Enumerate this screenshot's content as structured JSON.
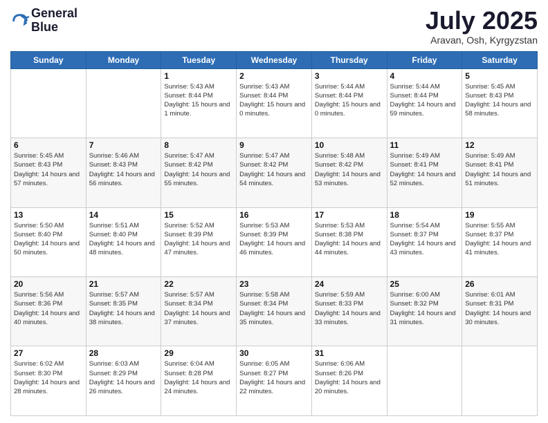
{
  "logo": {
    "line1": "General",
    "line2": "Blue"
  },
  "header": {
    "month": "July 2025",
    "location": "Aravan, Osh, Kyrgyzstan"
  },
  "weekdays": [
    "Sunday",
    "Monday",
    "Tuesday",
    "Wednesday",
    "Thursday",
    "Friday",
    "Saturday"
  ],
  "weeks": [
    [
      {
        "day": "",
        "sunrise": "",
        "sunset": "",
        "daylight": ""
      },
      {
        "day": "",
        "sunrise": "",
        "sunset": "",
        "daylight": ""
      },
      {
        "day": "1",
        "sunrise": "Sunrise: 5:43 AM",
        "sunset": "Sunset: 8:44 PM",
        "daylight": "Daylight: 15 hours and 1 minute."
      },
      {
        "day": "2",
        "sunrise": "Sunrise: 5:43 AM",
        "sunset": "Sunset: 8:44 PM",
        "daylight": "Daylight: 15 hours and 0 minutes."
      },
      {
        "day": "3",
        "sunrise": "Sunrise: 5:44 AM",
        "sunset": "Sunset: 8:44 PM",
        "daylight": "Daylight: 15 hours and 0 minutes."
      },
      {
        "day": "4",
        "sunrise": "Sunrise: 5:44 AM",
        "sunset": "Sunset: 8:44 PM",
        "daylight": "Daylight: 14 hours and 59 minutes."
      },
      {
        "day": "5",
        "sunrise": "Sunrise: 5:45 AM",
        "sunset": "Sunset: 8:43 PM",
        "daylight": "Daylight: 14 hours and 58 minutes."
      }
    ],
    [
      {
        "day": "6",
        "sunrise": "Sunrise: 5:45 AM",
        "sunset": "Sunset: 8:43 PM",
        "daylight": "Daylight: 14 hours and 57 minutes."
      },
      {
        "day": "7",
        "sunrise": "Sunrise: 5:46 AM",
        "sunset": "Sunset: 8:43 PM",
        "daylight": "Daylight: 14 hours and 56 minutes."
      },
      {
        "day": "8",
        "sunrise": "Sunrise: 5:47 AM",
        "sunset": "Sunset: 8:42 PM",
        "daylight": "Daylight: 14 hours and 55 minutes."
      },
      {
        "day": "9",
        "sunrise": "Sunrise: 5:47 AM",
        "sunset": "Sunset: 8:42 PM",
        "daylight": "Daylight: 14 hours and 54 minutes."
      },
      {
        "day": "10",
        "sunrise": "Sunrise: 5:48 AM",
        "sunset": "Sunset: 8:42 PM",
        "daylight": "Daylight: 14 hours and 53 minutes."
      },
      {
        "day": "11",
        "sunrise": "Sunrise: 5:49 AM",
        "sunset": "Sunset: 8:41 PM",
        "daylight": "Daylight: 14 hours and 52 minutes."
      },
      {
        "day": "12",
        "sunrise": "Sunrise: 5:49 AM",
        "sunset": "Sunset: 8:41 PM",
        "daylight": "Daylight: 14 hours and 51 minutes."
      }
    ],
    [
      {
        "day": "13",
        "sunrise": "Sunrise: 5:50 AM",
        "sunset": "Sunset: 8:40 PM",
        "daylight": "Daylight: 14 hours and 50 minutes."
      },
      {
        "day": "14",
        "sunrise": "Sunrise: 5:51 AM",
        "sunset": "Sunset: 8:40 PM",
        "daylight": "Daylight: 14 hours and 48 minutes."
      },
      {
        "day": "15",
        "sunrise": "Sunrise: 5:52 AM",
        "sunset": "Sunset: 8:39 PM",
        "daylight": "Daylight: 14 hours and 47 minutes."
      },
      {
        "day": "16",
        "sunrise": "Sunrise: 5:53 AM",
        "sunset": "Sunset: 8:39 PM",
        "daylight": "Daylight: 14 hours and 46 minutes."
      },
      {
        "day": "17",
        "sunrise": "Sunrise: 5:53 AM",
        "sunset": "Sunset: 8:38 PM",
        "daylight": "Daylight: 14 hours and 44 minutes."
      },
      {
        "day": "18",
        "sunrise": "Sunrise: 5:54 AM",
        "sunset": "Sunset: 8:37 PM",
        "daylight": "Daylight: 14 hours and 43 minutes."
      },
      {
        "day": "19",
        "sunrise": "Sunrise: 5:55 AM",
        "sunset": "Sunset: 8:37 PM",
        "daylight": "Daylight: 14 hours and 41 minutes."
      }
    ],
    [
      {
        "day": "20",
        "sunrise": "Sunrise: 5:56 AM",
        "sunset": "Sunset: 8:36 PM",
        "daylight": "Daylight: 14 hours and 40 minutes."
      },
      {
        "day": "21",
        "sunrise": "Sunrise: 5:57 AM",
        "sunset": "Sunset: 8:35 PM",
        "daylight": "Daylight: 14 hours and 38 minutes."
      },
      {
        "day": "22",
        "sunrise": "Sunrise: 5:57 AM",
        "sunset": "Sunset: 8:34 PM",
        "daylight": "Daylight: 14 hours and 37 minutes."
      },
      {
        "day": "23",
        "sunrise": "Sunrise: 5:58 AM",
        "sunset": "Sunset: 8:34 PM",
        "daylight": "Daylight: 14 hours and 35 minutes."
      },
      {
        "day": "24",
        "sunrise": "Sunrise: 5:59 AM",
        "sunset": "Sunset: 8:33 PM",
        "daylight": "Daylight: 14 hours and 33 minutes."
      },
      {
        "day": "25",
        "sunrise": "Sunrise: 6:00 AM",
        "sunset": "Sunset: 8:32 PM",
        "daylight": "Daylight: 14 hours and 31 minutes."
      },
      {
        "day": "26",
        "sunrise": "Sunrise: 6:01 AM",
        "sunset": "Sunset: 8:31 PM",
        "daylight": "Daylight: 14 hours and 30 minutes."
      }
    ],
    [
      {
        "day": "27",
        "sunrise": "Sunrise: 6:02 AM",
        "sunset": "Sunset: 8:30 PM",
        "daylight": "Daylight: 14 hours and 28 minutes."
      },
      {
        "day": "28",
        "sunrise": "Sunrise: 6:03 AM",
        "sunset": "Sunset: 8:29 PM",
        "daylight": "Daylight: 14 hours and 26 minutes."
      },
      {
        "day": "29",
        "sunrise": "Sunrise: 6:04 AM",
        "sunset": "Sunset: 8:28 PM",
        "daylight": "Daylight: 14 hours and 24 minutes."
      },
      {
        "day": "30",
        "sunrise": "Sunrise: 6:05 AM",
        "sunset": "Sunset: 8:27 PM",
        "daylight": "Daylight: 14 hours and 22 minutes."
      },
      {
        "day": "31",
        "sunrise": "Sunrise: 6:06 AM",
        "sunset": "Sunset: 8:26 PM",
        "daylight": "Daylight: 14 hours and 20 minutes."
      },
      {
        "day": "",
        "sunrise": "",
        "sunset": "",
        "daylight": ""
      },
      {
        "day": "",
        "sunrise": "",
        "sunset": "",
        "daylight": ""
      }
    ]
  ]
}
